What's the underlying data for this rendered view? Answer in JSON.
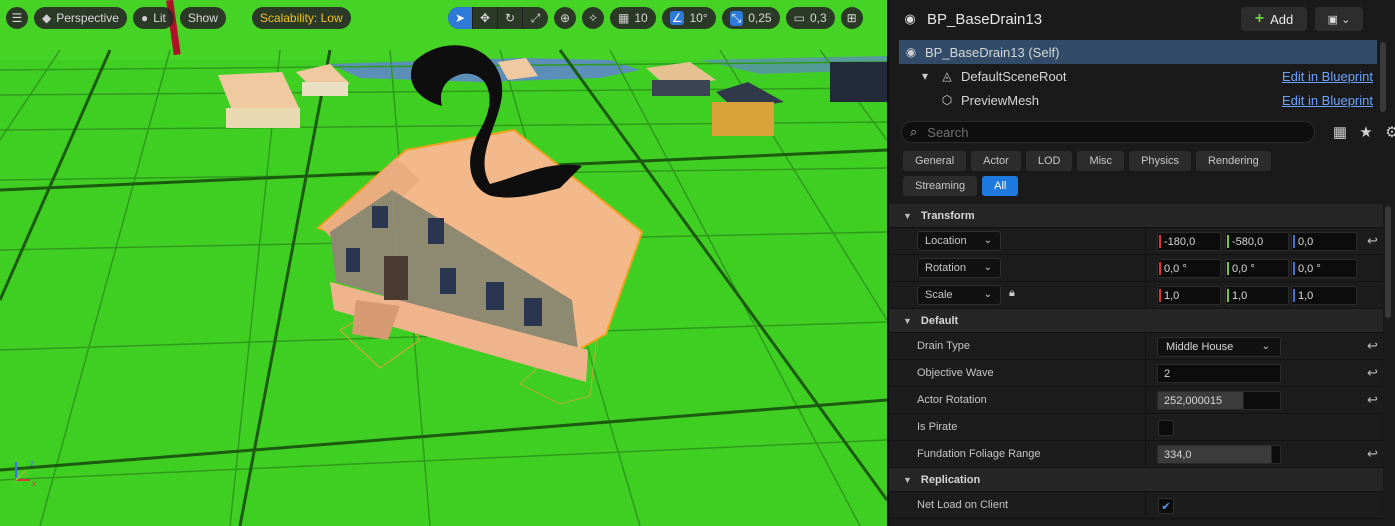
{
  "viewport": {
    "menu_icon": "hamburger-icon",
    "view_mode": "Perspective",
    "lighting": "Lit",
    "show": "Show",
    "scalability": "Scalability: Low",
    "grid_snap": "10",
    "rotation_snap": "10°",
    "scale_snap": "0,25",
    "camera_speed": "0,3",
    "axis": {
      "x": "x",
      "y": "y",
      "z": "z"
    }
  },
  "details": {
    "title": "BP_BaseDrain13",
    "add_label": "Add",
    "components": [
      {
        "label": "BP_BaseDrain13 (Self)",
        "link": ""
      },
      {
        "label": "DefaultSceneRoot",
        "link": "Edit in Blueprint"
      },
      {
        "label": "PreviewMesh",
        "link": "Edit in Blueprint"
      }
    ],
    "search_placeholder": "Search",
    "tabs": [
      "General",
      "Actor",
      "LOD",
      "Misc",
      "Physics",
      "Rendering",
      "Streaming",
      "All"
    ],
    "active_tab": "All",
    "sections": {
      "transform": "Transform",
      "default": "Default",
      "replication": "Replication"
    },
    "transform": {
      "location": {
        "label": "Location",
        "x": "-180,0",
        "y": "-580,0",
        "z": "0,0"
      },
      "rotation": {
        "label": "Rotation",
        "x": "0,0 °",
        "y": "0,0 °",
        "z": "0,0 °"
      },
      "scale": {
        "label": "Scale",
        "x": "1,0",
        "y": "1,0",
        "z": "1,0"
      }
    },
    "default": {
      "drain_type": {
        "label": "Drain Type",
        "value": "Middle House"
      },
      "objective_wave": {
        "label": "Objective Wave",
        "value": "2"
      },
      "actor_rotation": {
        "label": "Actor Rotation",
        "value": "252,000015"
      },
      "is_pirate": {
        "label": "Is Pirate",
        "checked": false
      },
      "foliage_range": {
        "label": "Fundation Foliage Range",
        "value": "334,0"
      }
    },
    "replication": {
      "net_load": {
        "label": "Net Load on Client",
        "checked": true
      }
    }
  }
}
